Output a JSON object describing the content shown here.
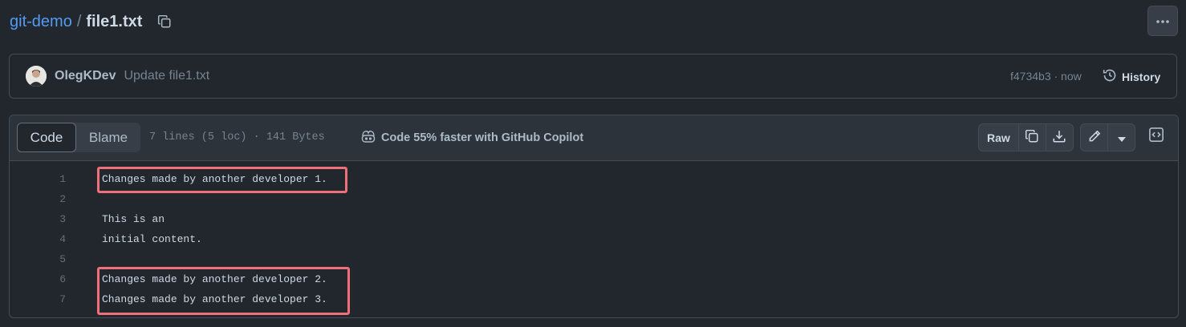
{
  "breadcrumb": {
    "repo": "git-demo",
    "separator": "/",
    "file": "file1.txt"
  },
  "commit": {
    "author": "OlegKDev",
    "message": "Update file1.txt",
    "sha_time": "f4734b3 · now",
    "history_label": "History"
  },
  "file_header": {
    "tabs": [
      {
        "label": "Code",
        "active": true
      },
      {
        "label": "Blame",
        "active": false
      }
    ],
    "info": "7 lines (5 loc) · 141 Bytes",
    "copilot": "Code 55% faster with GitHub Copilot",
    "raw_label": "Raw"
  },
  "code_lines": [
    {
      "num": "1",
      "text": "Changes made by another developer 1."
    },
    {
      "num": "2",
      "text": ""
    },
    {
      "num": "3",
      "text": "This is an"
    },
    {
      "num": "4",
      "text": "initial content."
    },
    {
      "num": "5",
      "text": ""
    },
    {
      "num": "6",
      "text": "Changes made by another developer 2."
    },
    {
      "num": "7",
      "text": "Changes made by another developer 3."
    }
  ],
  "colors": {
    "background": "#22272e",
    "link": "#539bf5",
    "highlight_box": "#ef6f7b"
  },
  "icons": [
    "copy-icon",
    "kebab-icon",
    "history-icon",
    "copilot-icon",
    "download-icon",
    "pencil-icon",
    "caret-down-icon",
    "code-square-icon"
  ]
}
